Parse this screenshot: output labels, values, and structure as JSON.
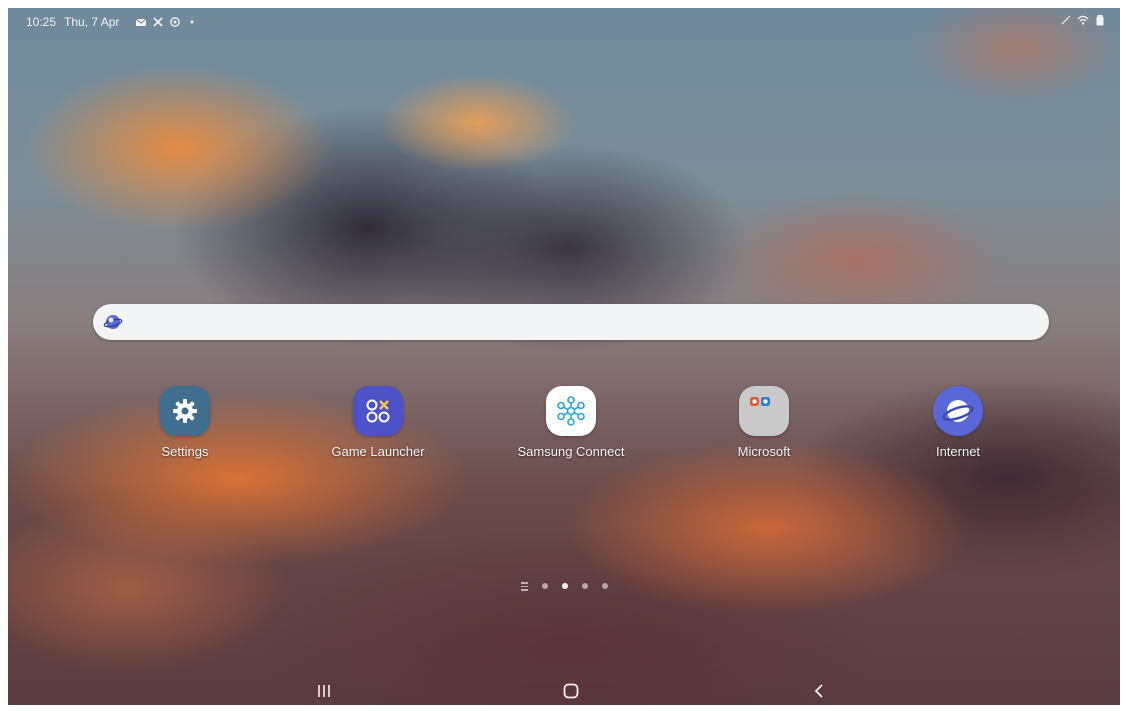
{
  "status_bar": {
    "time": "10:25",
    "date": "Thu, 7 Apr",
    "left_icons": [
      "email-icon",
      "missed-call-icon",
      "sync-icon",
      "dot-icon"
    ],
    "right_icons": [
      "signal-icon",
      "wifi-icon",
      "battery-icon"
    ]
  },
  "search": {
    "logo": "samsung-internet-icon",
    "placeholder": ""
  },
  "apps": [
    {
      "label": "Settings",
      "icon": "gear-icon",
      "color": "#3f6e8f"
    },
    {
      "label": "Game Launcher",
      "icon": "game-launcher-icon",
      "color": "#4d52c9"
    },
    {
      "label": "Samsung Connect",
      "icon": "samsung-connect-icon",
      "color": "#ffffff"
    },
    {
      "label": "Microsoft",
      "icon": "folder-icon",
      "color": "#c9c9c9"
    },
    {
      "label": "Internet",
      "icon": "internet-icon",
      "color": "#5a67d8"
    }
  ],
  "page_indicator": {
    "pages": 4,
    "active_page": 2
  },
  "nav_bar": {
    "recents": "recents-icon",
    "home": "home-icon",
    "back": "back-icon"
  }
}
